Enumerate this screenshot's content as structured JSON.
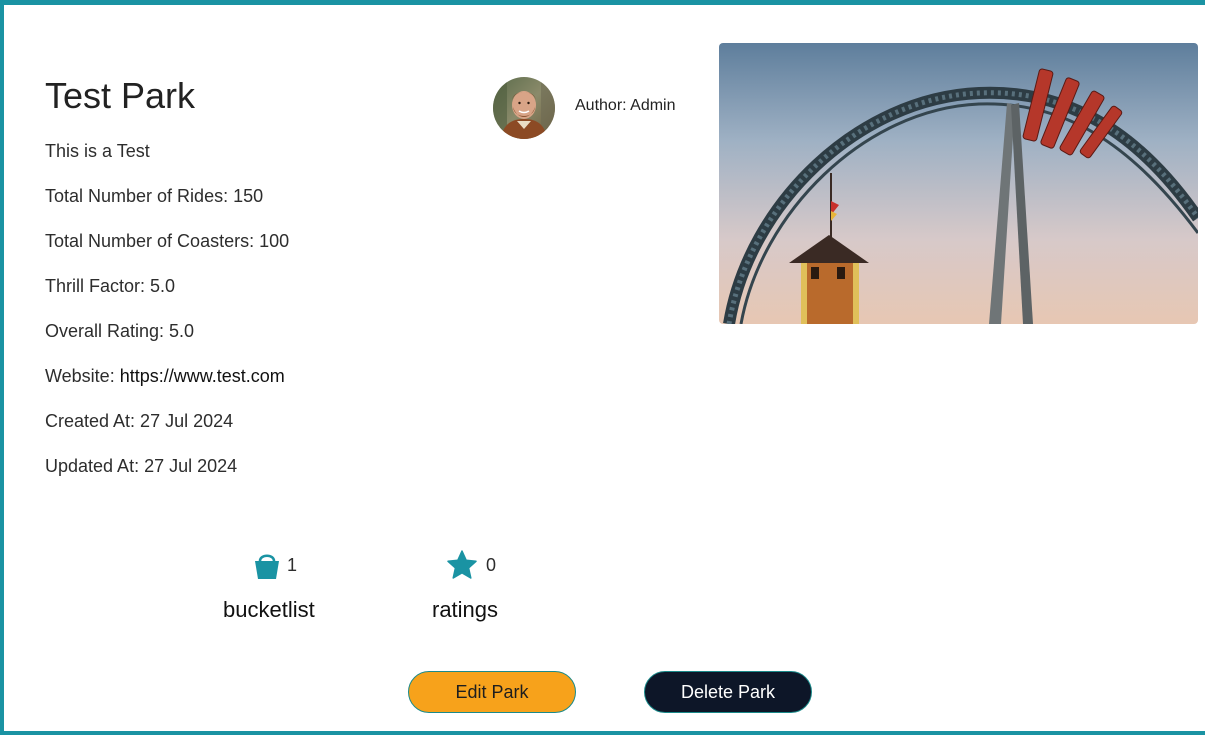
{
  "park": {
    "name": "Test Park",
    "description": "This is a Test",
    "total_rides": "Total Number of Rides: 150",
    "total_coasters": "Total Number of Coasters: 100",
    "thrill_factor": "Thrill Factor: 5.0",
    "overall_rating": "Overall Rating: 5.0",
    "website_label": "Website: ",
    "website_url": "https://www.test.com",
    "created_at": "Created At: 27 Jul 2024",
    "updated_at": "Updated At: 27 Jul 2024"
  },
  "author": {
    "label": "Author: Admin",
    "avatar_icon": "avatar"
  },
  "stats": {
    "bucketlist": {
      "icon": "bucket-icon",
      "count": "1",
      "label": "bucketlist"
    },
    "ratings": {
      "icon": "star-icon",
      "count": "0",
      "label": "ratings"
    }
  },
  "actions": {
    "edit_label": "Edit Park",
    "delete_label": "Delete Park"
  },
  "colors": {
    "accent": "#1a93a3",
    "edit_button": "#f7a21b",
    "delete_button": "#0d1628"
  }
}
